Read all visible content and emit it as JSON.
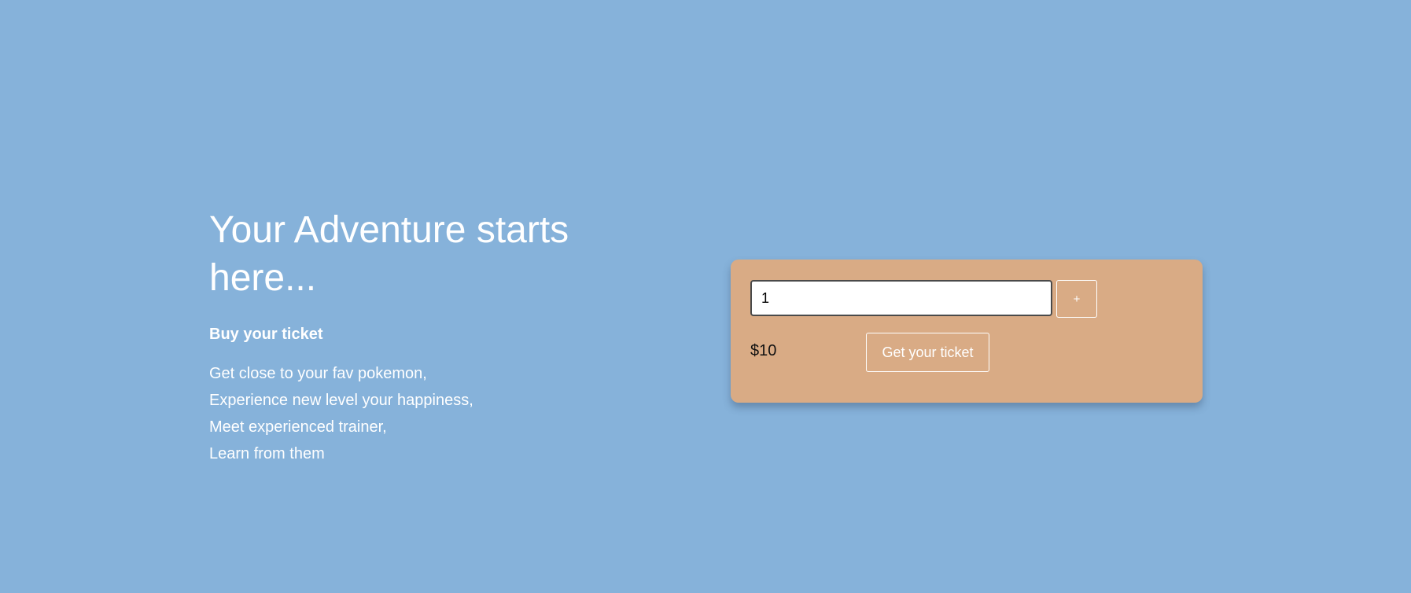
{
  "hero": {
    "title_line1": "Your Adventure starts",
    "title_line2": "here...",
    "subtitle": "Buy your ticket",
    "features": [
      "Get close to your fav pokemon,",
      "Experience new level your happiness,",
      "Meet experienced trainer,",
      "Learn from them"
    ]
  },
  "ticket_card": {
    "quantity_value": "1",
    "plus_label": "+",
    "price": "$10",
    "get_ticket_label": "Get your ticket"
  },
  "colors": {
    "background": "#86b2da",
    "card": "#d9ab85",
    "text_light": "#ffffff"
  }
}
